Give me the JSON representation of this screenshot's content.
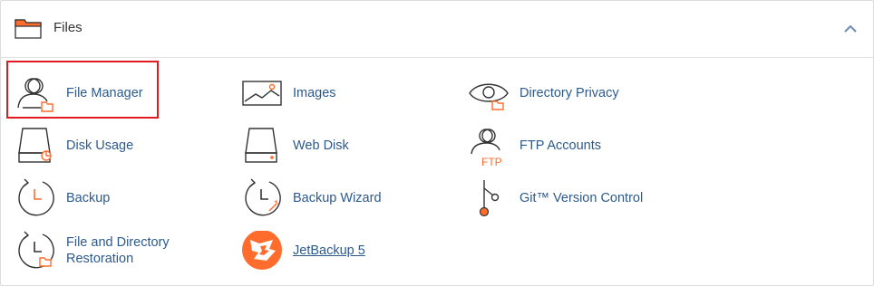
{
  "section": {
    "title": "Files",
    "icon": "folder-icon",
    "collapse_icon": "chevron-up-icon"
  },
  "colors": {
    "accent": "#ff6c2c",
    "link": "#2d5a8c",
    "highlight": "#e01b22",
    "icon_stroke": "#333333"
  },
  "items": [
    {
      "label": "File Manager",
      "icon": "file-manager-icon",
      "highlighted": true
    },
    {
      "label": "Images",
      "icon": "images-icon"
    },
    {
      "label": "Directory Privacy",
      "icon": "directory-privacy-icon"
    },
    {
      "label": "Disk Usage",
      "icon": "disk-usage-icon"
    },
    {
      "label": "Web Disk",
      "icon": "web-disk-icon"
    },
    {
      "label": "FTP Accounts",
      "icon": "ftp-accounts-icon",
      "icon_text": "FTP"
    },
    {
      "label": "Backup",
      "icon": "backup-icon"
    },
    {
      "label": "Backup Wizard",
      "icon": "backup-wizard-icon"
    },
    {
      "label": "Git™ Version Control",
      "icon": "git-version-control-icon"
    },
    {
      "label": "File and Directory Restoration",
      "icon": "file-directory-restoration-icon"
    },
    {
      "label": "JetBackup 5",
      "icon": "jetbackup-icon"
    }
  ]
}
